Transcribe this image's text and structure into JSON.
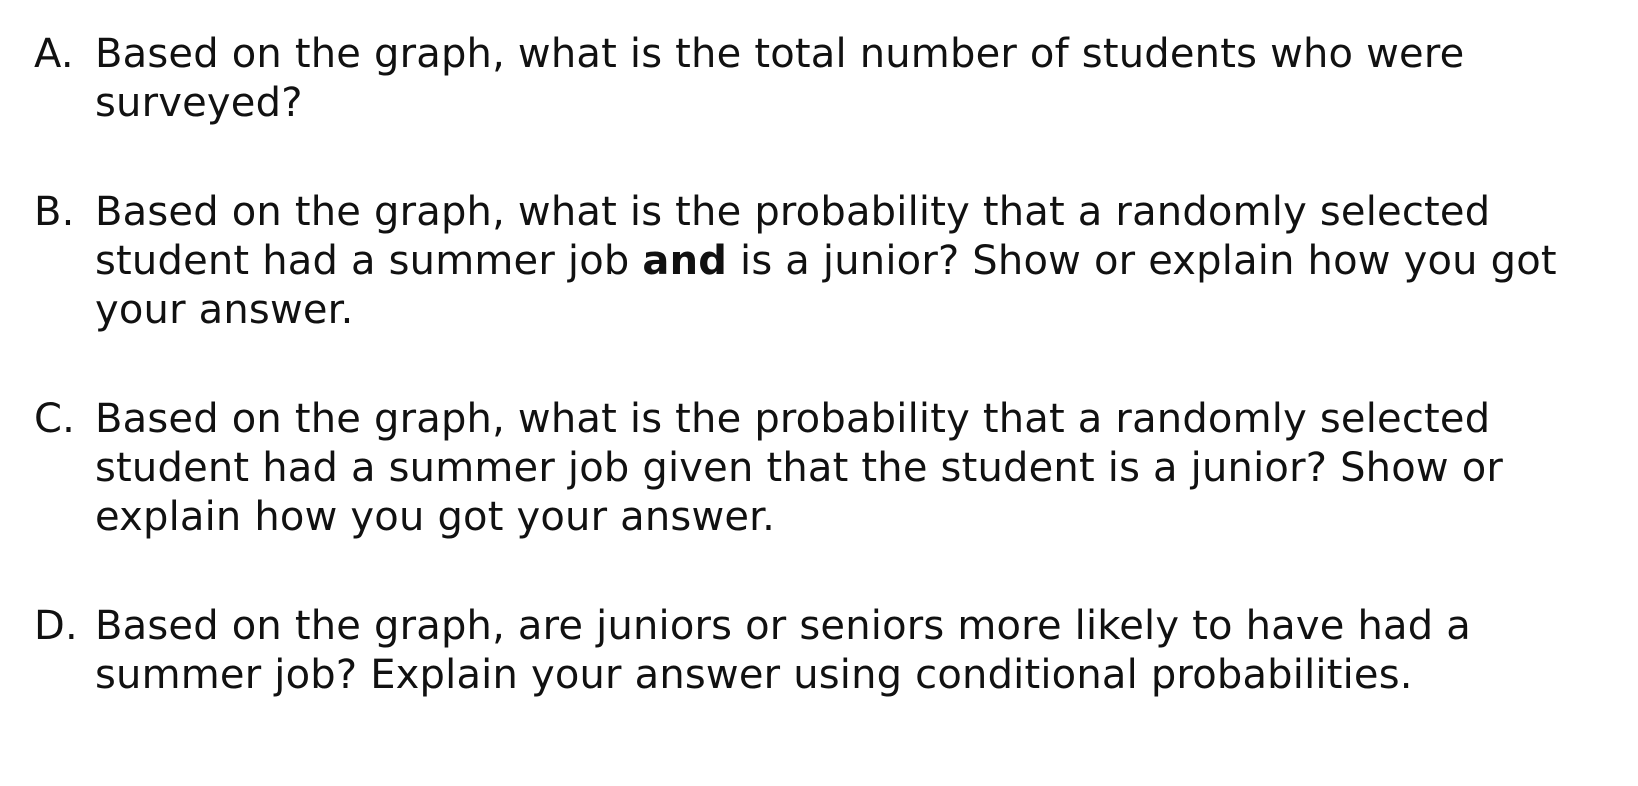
{
  "questions": [
    {
      "letter": "A.",
      "text_before": "Based on the graph, what is the total number of students who were surveyed?",
      "bold": "",
      "text_after": ""
    },
    {
      "letter": "B.",
      "text_before": "Based on the graph, what is the probability that a randomly selected student had a summer job ",
      "bold": "and",
      "text_after": " is a junior? Show or explain how you got your answer."
    },
    {
      "letter": "C.",
      "text_before": "Based on the graph, what is the probability that a randomly selected student had a summer job given that the student is a junior? Show or explain how you got your answer.",
      "bold": "",
      "text_after": ""
    },
    {
      "letter": "D.",
      "text_before": "Based on the graph, are juniors or seniors more likely to have had a summer job? Explain your answer using conditional probabilities.",
      "bold": "",
      "text_after": ""
    }
  ]
}
